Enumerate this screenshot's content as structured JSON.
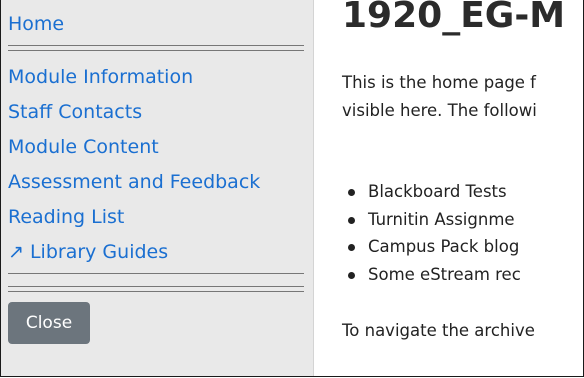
{
  "sidebar": {
    "home": "Home",
    "items": [
      {
        "label": "Module Information"
      },
      {
        "label": "Staff Contacts"
      },
      {
        "label": "Module Content"
      },
      {
        "label": "Assessment and Feedback"
      },
      {
        "label": "Reading List"
      },
      {
        "label": "↗ Library Guides"
      }
    ],
    "close_label": "Close"
  },
  "main": {
    "title": "1920_EG-M",
    "intro_line1": "This is the home page f",
    "intro_line2": "visible here. The followi",
    "bullets": [
      "Blackboard Tests",
      "Turnitin Assignme",
      "Campus Pack blog",
      "Some eStream rec"
    ],
    "navigate_text": "To navigate the archive"
  },
  "colors": {
    "link": "#1a6fd1",
    "sidebar_bg": "#e9e9e9",
    "button_bg": "#6c757d"
  }
}
